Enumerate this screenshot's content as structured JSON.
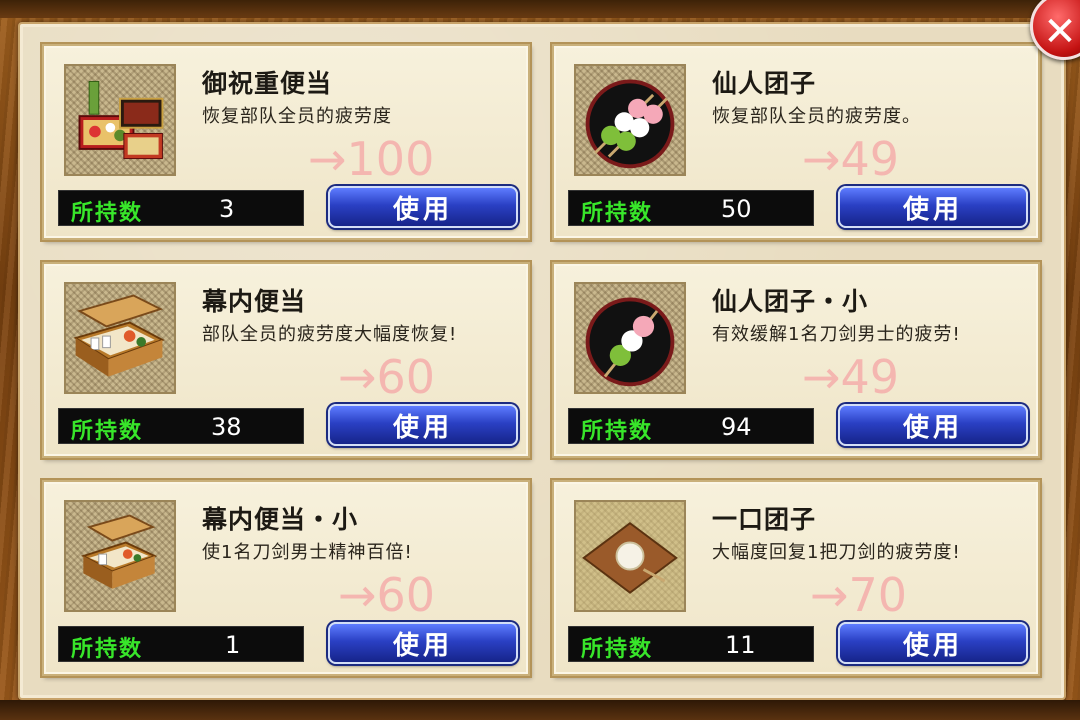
{
  "ui": {
    "count_label": "所持数",
    "use_label": "使用",
    "close_symbol": "✕"
  },
  "items": [
    {
      "name": "御祝重便当",
      "desc": "恢复部队全员的疲劳度",
      "recovery": "→100",
      "count": "3",
      "icon": "jubako-bento-icon"
    },
    {
      "name": "仙人团子",
      "desc": "恢复部队全员的疲劳度。",
      "recovery": "→49",
      "count": "50",
      "icon": "dango-plate-icon"
    },
    {
      "name": "幕内便当",
      "desc": "部队全员的疲劳度大幅度恢复!",
      "recovery": "→60",
      "count": "38",
      "icon": "makunouchi-bento-icon"
    },
    {
      "name": "仙人团子・小",
      "desc": "有效缓解1名刀剑男士的疲劳!",
      "recovery": "→49",
      "count": "94",
      "icon": "dango-small-icon"
    },
    {
      "name": "幕内便当・小",
      "desc": "使1名刀剑男士精神百倍!",
      "recovery": "→60",
      "count": "1",
      "icon": "makunouchi-small-icon"
    },
    {
      "name": "一口团子",
      "desc": "大幅度回复1把刀剑的疲劳度!",
      "recovery": "→70",
      "count": "11",
      "icon": "hitokuchi-dango-icon"
    }
  ],
  "colors": {
    "count_label": "#38e62a",
    "recovery_text": "#f4b6b0",
    "use_button": "#2a40c4",
    "close_button": "#c41212"
  }
}
